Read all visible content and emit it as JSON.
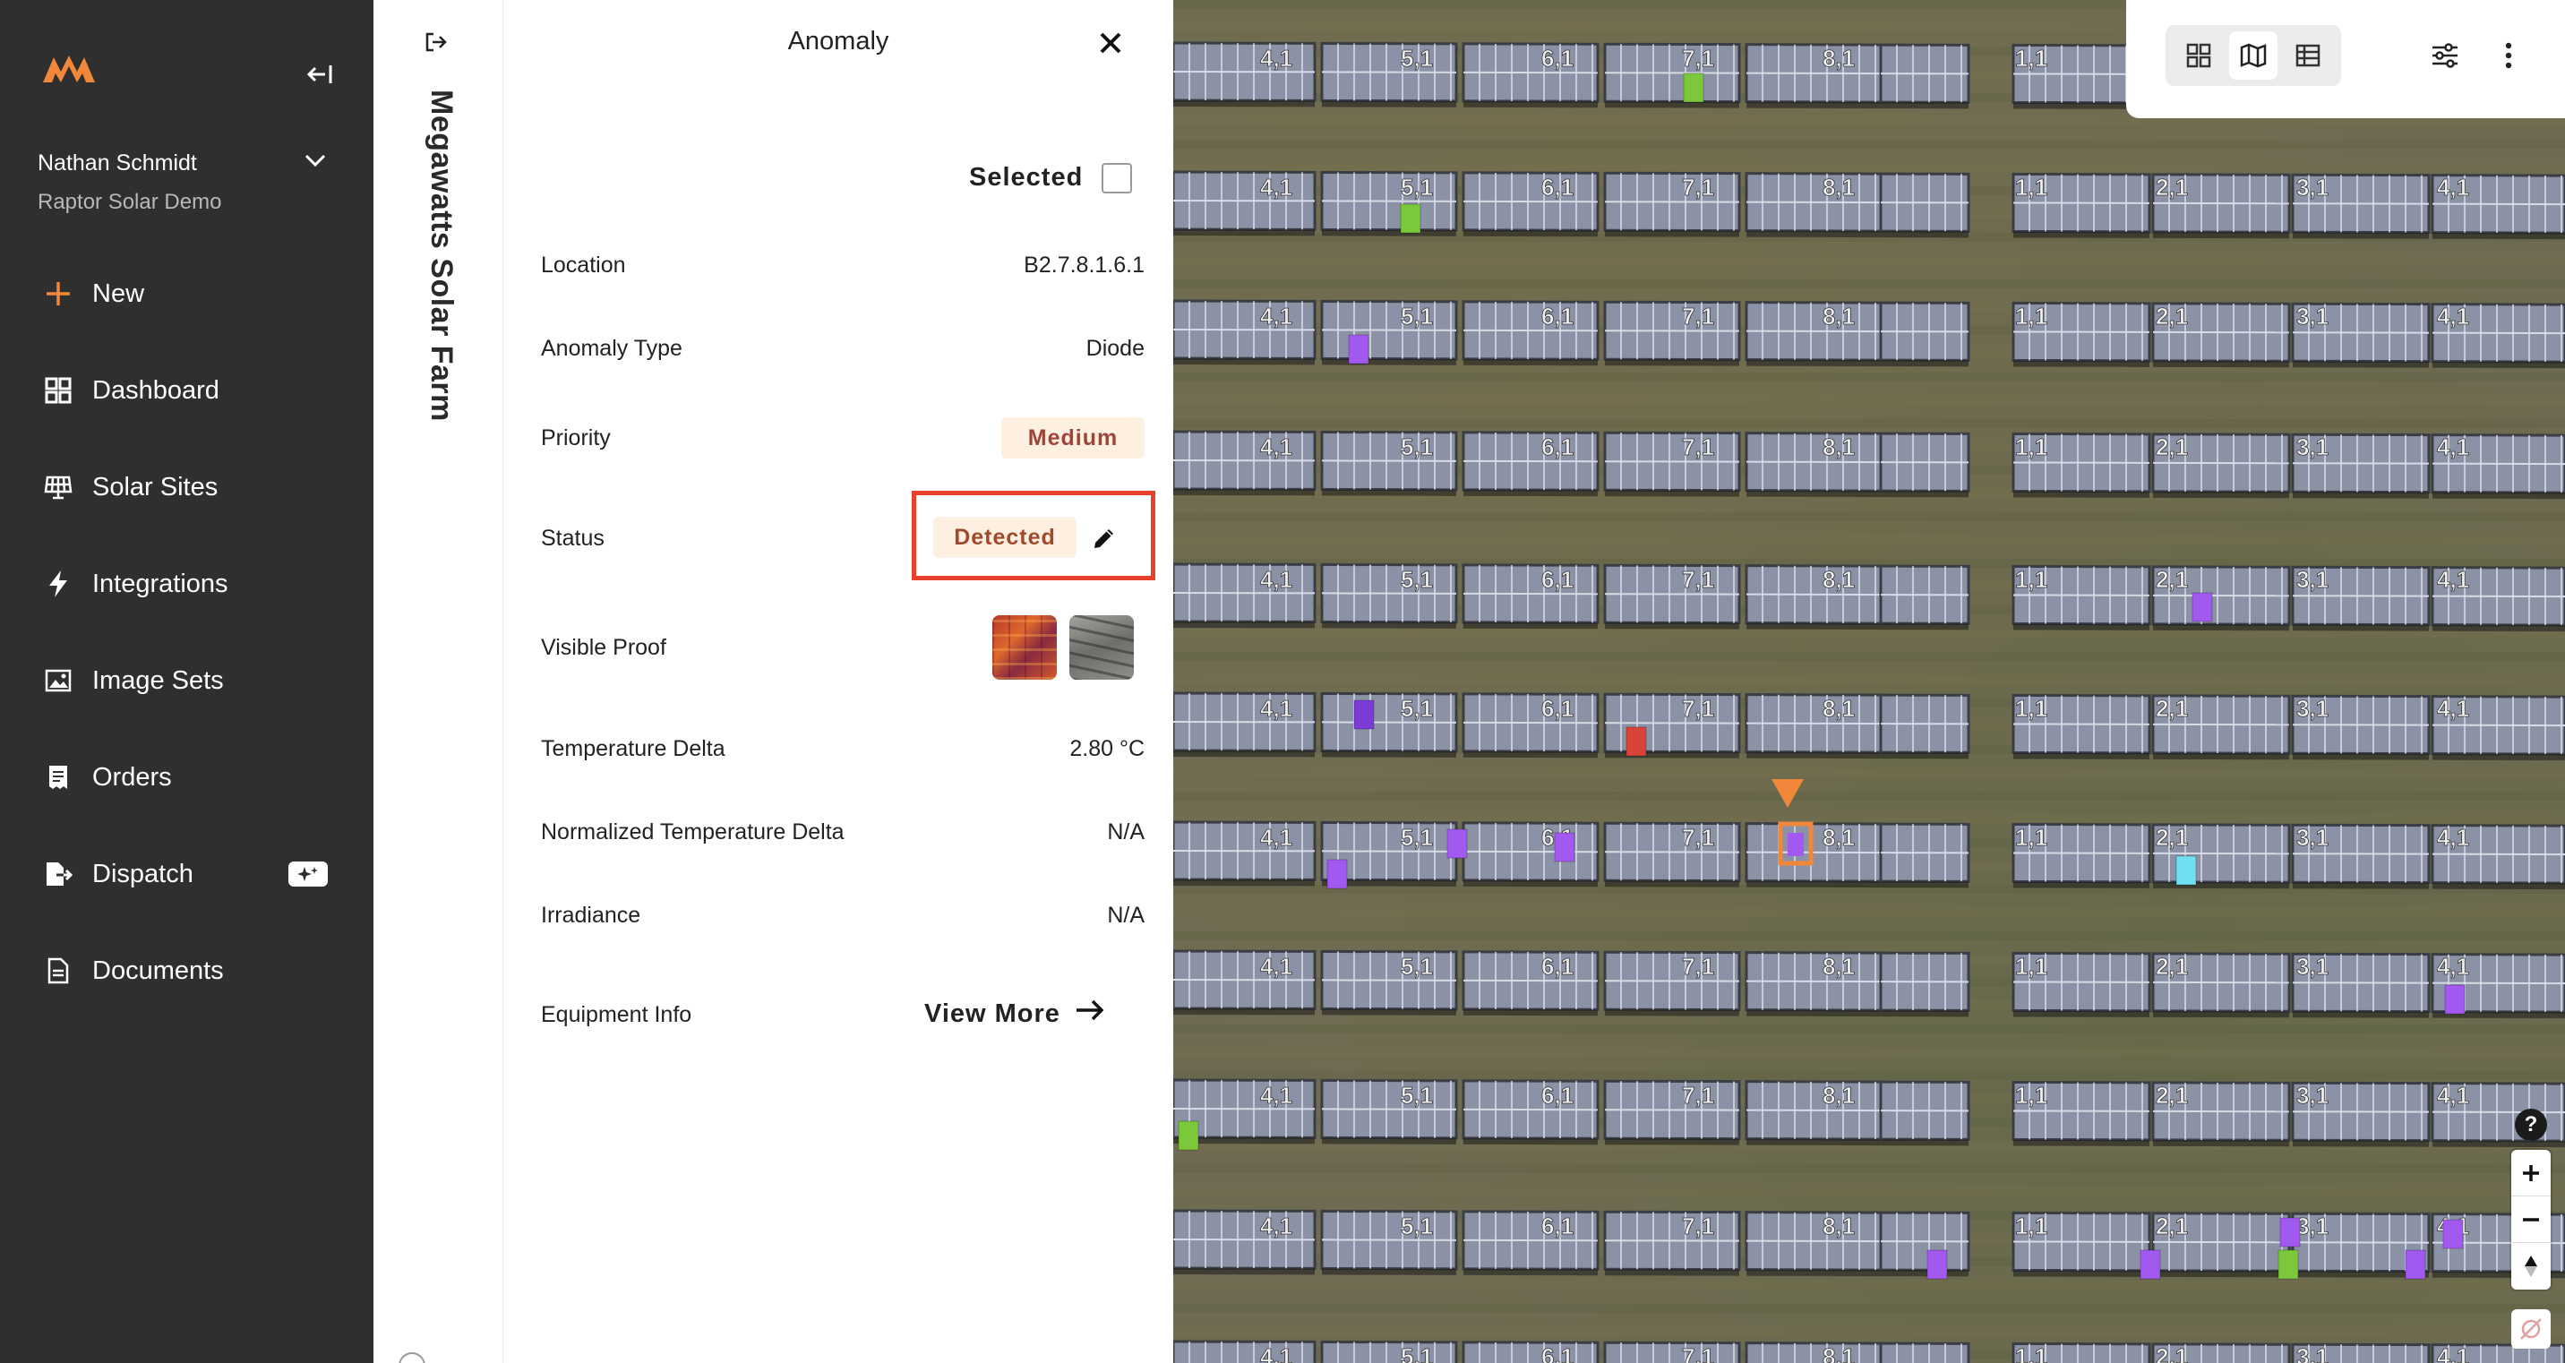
{
  "sidebar": {
    "logo_icon": "raptor-logo-icon",
    "user_name": "Nathan Schmidt",
    "org_name": "Raptor Solar Demo",
    "items": [
      {
        "label": "New",
        "icon": "plus-icon"
      },
      {
        "label": "Dashboard",
        "icon": "grid-icon"
      },
      {
        "label": "Solar Sites",
        "icon": "solar-panel-icon"
      },
      {
        "label": "Integrations",
        "icon": "lightning-icon"
      },
      {
        "label": "Image Sets",
        "icon": "image-icon"
      },
      {
        "label": "Orders",
        "icon": "receipt-icon"
      },
      {
        "label": "Dispatch",
        "icon": "dispatch-icon"
      },
      {
        "label": "Documents",
        "icon": "document-icon"
      }
    ]
  },
  "site": {
    "name": "Megawatts Solar Farm"
  },
  "panel": {
    "title": "Anomaly",
    "selected_label": "Selected",
    "selected_checked": false,
    "location_label": "Location",
    "location_value": "B2.7.8.1.6.1",
    "anomaly_type_label": "Anomaly Type",
    "anomaly_type_value": "Diode",
    "priority_label": "Priority",
    "priority_value": "Medium",
    "status_label": "Status",
    "status_value": "Detected",
    "visible_proof_label": "Visible Proof",
    "temperature_delta_label": "Temperature Delta",
    "temperature_delta_value": "2.80 °C",
    "normalized_temp_delta_label": "Normalized Temperature Delta",
    "normalized_temp_delta_value": "N/A",
    "irradiance_label": "Irradiance",
    "irradiance_value": "N/A",
    "equipment_info_label": "Equipment Info",
    "view_more_label": "View More"
  },
  "map": {
    "block_labels_left": [
      "4,1",
      "5,1",
      "6,1",
      "7,1",
      "8,1"
    ],
    "block_labels_right": [
      "1,1",
      "2,1",
      "3,1",
      "4,1"
    ],
    "help_label": "?",
    "colors": {
      "purple": "#a259f0",
      "dark_purple": "#7a3bd6",
      "green": "#7bc83a",
      "red": "#d9443a",
      "cyan": "#6fe0f0",
      "selection": "#f0873a"
    }
  }
}
